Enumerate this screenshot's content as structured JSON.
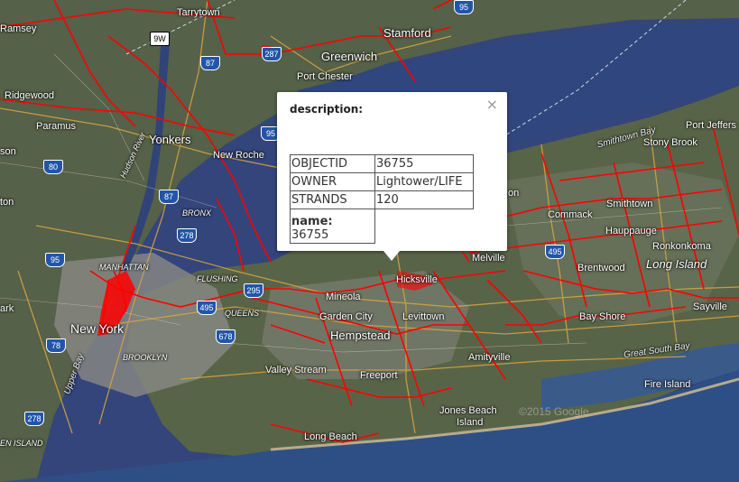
{
  "map": {
    "labels": {
      "tarrytown": "Tarrytown",
      "ramsey": "Ramsey",
      "stamford": "Stamford",
      "greenwich": "Greenwich",
      "port_chester": "Port Chester",
      "ridgewood": "Ridgewood",
      "paramus": "Paramus",
      "yonkers": "Yonkers",
      "new_rochelle": "New Roche",
      "hudson_river": "Hudson River",
      "bronx": "BRONX",
      "manhattan": "MANHATTAN",
      "flushing": "FLUSHING",
      "queens": "QUEENS",
      "new_york": "New York",
      "brooklyn": "BROOKLYN",
      "upper_bay": "Upper Bay",
      "en_island": "EN ISLAND",
      "valley_stream": "Valley Stream",
      "freeport": "Freeport",
      "long_beach": "Long Beach",
      "jones_beach": "Jones Beach",
      "island": "Island",
      "mineola": "Mineola",
      "hicksville": "Hicksville",
      "garden_city": "Garden City",
      "levittown": "Levittown",
      "hempstead": "Hempstead",
      "amityville": "Amityville",
      "melville": "Melville",
      "commack": "Commack",
      "hauppauge": "Hauppauge",
      "ronkonkoma": "Ronkonkoma",
      "long_island": "Long Island",
      "brentwood": "Brentwood",
      "bay_shore": "Bay Shore",
      "great_south_bay": "Great South Bay",
      "fire_island": "Fire Island",
      "sayville": "Sayville",
      "smithtown": "Smithtown",
      "stony_brook": "Stony Brook",
      "smithtown_bay": "Smithtown Bay",
      "port_jeffers": "Port Jeffers",
      "on": "on",
      "son": "son",
      "ton": "ton",
      "ark": "ark"
    },
    "shields": {
      "s9w": "9W",
      "s87a": "87",
      "s87b": "87",
      "s95a": "95",
      "s95b": "95",
      "s95c": "95",
      "s80": "80",
      "s287": "287",
      "s278a": "278",
      "s278b": "278",
      "s495a": "495",
      "s495b": "495",
      "s678": "678",
      "s78": "78",
      "s295": "295"
    },
    "watermark": "©2015 Google"
  },
  "popup": {
    "description_label": "description:",
    "close_label": "×",
    "rows": [
      {
        "key": "OBJECTID",
        "value": "36755"
      },
      {
        "key": "OWNER",
        "value": "Lightower/LIFE"
      },
      {
        "key": "STRANDS",
        "value": "120"
      }
    ],
    "name_label": "name:",
    "name_value": "36755"
  }
}
